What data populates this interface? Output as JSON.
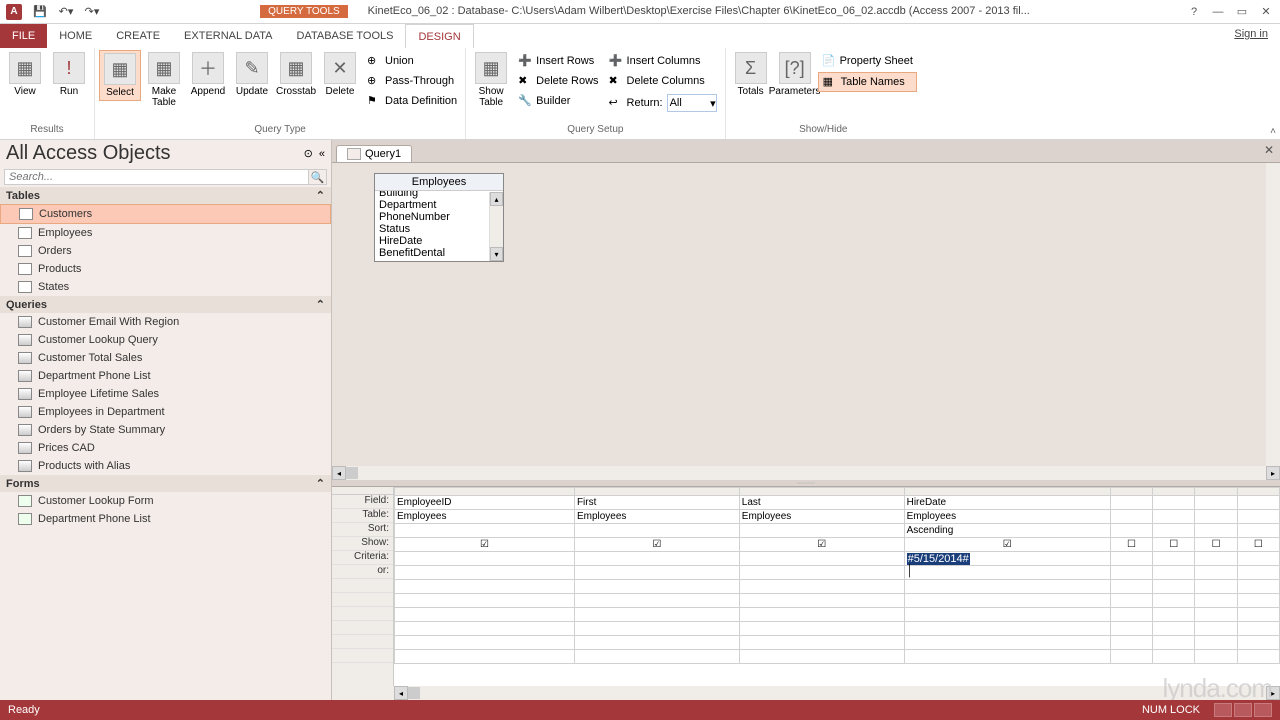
{
  "titlebar": {
    "query_tools": "QUERY TOOLS",
    "title": "KinetEco_06_02 : Database- C:\\Users\\Adam Wilbert\\Desktop\\Exercise Files\\Chapter 6\\KinetEco_06_02.accdb (Access 2007 - 2013 fil..."
  },
  "tabs": {
    "file": "FILE",
    "home": "HOME",
    "create": "CREATE",
    "external": "EXTERNAL DATA",
    "dbtools": "DATABASE TOOLS",
    "design": "DESIGN",
    "signin": "Sign in"
  },
  "ribbon": {
    "results": {
      "view": "View",
      "run": "Run",
      "label": "Results"
    },
    "querytype": {
      "select": "Select",
      "make": "Make\nTable",
      "append": "Append",
      "update": "Update",
      "crosstab": "Crosstab",
      "delete": "Delete",
      "union": "Union",
      "passthrough": "Pass-Through",
      "datadef": "Data Definition",
      "label": "Query Type"
    },
    "querysetup": {
      "showtable": "Show\nTable",
      "insertrows": "Insert Rows",
      "deleterows": "Delete Rows",
      "builder": "Builder",
      "insertcols": "Insert Columns",
      "deletecols": "Delete Columns",
      "return": "Return:",
      "returnval": "All",
      "label": "Query Setup"
    },
    "showhide": {
      "totals": "Totals",
      "parameters": "Parameters",
      "propsheet": "Property Sheet",
      "tablenames": "Table Names",
      "label": "Show/Hide"
    }
  },
  "nav": {
    "title": "All Access Objects",
    "search_ph": "Search...",
    "groups": {
      "tables": "Tables",
      "queries": "Queries",
      "forms": "Forms"
    },
    "tables": [
      "Customers",
      "Employees",
      "Orders",
      "Products",
      "States"
    ],
    "queries": [
      "Customer Email With Region",
      "Customer Lookup Query",
      "Customer Total Sales",
      "Department Phone List",
      "Employee Lifetime Sales",
      "Employees in Department",
      "Orders by State Summary",
      "Prices CAD",
      "Products with Alias"
    ],
    "forms": [
      "Customer Lookup Form",
      "Department Phone List"
    ]
  },
  "doc": {
    "tab": "Query1",
    "table_box": {
      "title": "Employees",
      "fields": [
        "Building",
        "Department",
        "PhoneNumber",
        "Status",
        "HireDate",
        "BenefitDental"
      ]
    }
  },
  "grid": {
    "labels": {
      "field": "Field:",
      "table": "Table:",
      "sort": "Sort:",
      "show": "Show:",
      "criteria": "Criteria:",
      "or": "or:"
    },
    "cols": [
      {
        "field": "EmployeeID",
        "table": "Employees",
        "sort": "",
        "show": true,
        "criteria": ""
      },
      {
        "field": "First",
        "table": "Employees",
        "sort": "",
        "show": true,
        "criteria": ""
      },
      {
        "field": "Last",
        "table": "Employees",
        "sort": "",
        "show": true,
        "criteria": ""
      },
      {
        "field": "HireDate",
        "table": "Employees",
        "sort": "Ascending",
        "show": true,
        "criteria": "#5/15/2014#"
      },
      {
        "field": "",
        "table": "",
        "sort": "",
        "show": false,
        "criteria": ""
      },
      {
        "field": "",
        "table": "",
        "sort": "",
        "show": false,
        "criteria": ""
      },
      {
        "field": "",
        "table": "",
        "sort": "",
        "show": false,
        "criteria": ""
      },
      {
        "field": "",
        "table": "",
        "sort": "",
        "show": false,
        "criteria": ""
      }
    ]
  },
  "status": {
    "ready": "Ready",
    "numlock": "NUM LOCK"
  },
  "watermark": "lynda.com"
}
